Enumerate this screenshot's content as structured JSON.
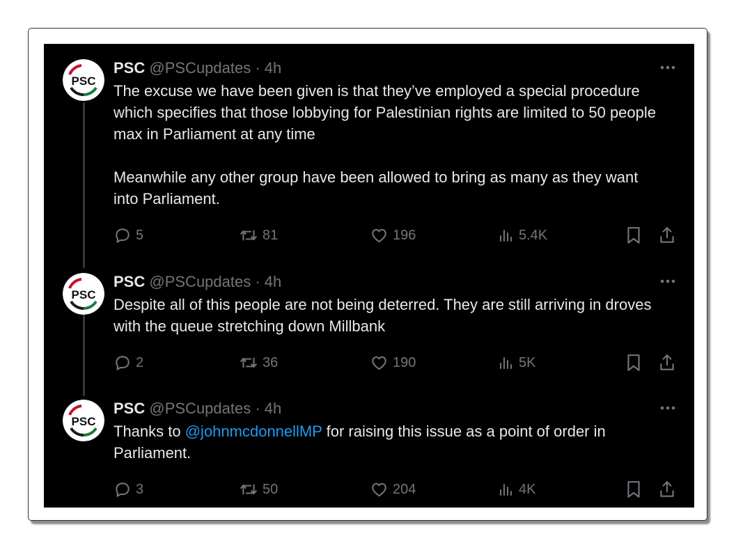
{
  "tweets": [
    {
      "author_name": "PSC",
      "handle": "@PSCupdates",
      "time": "· 4h",
      "avatar_text": "PSC",
      "paragraphs": [
        "The excuse we have been given is that they’ve employed a special procedure which specifies that those lobbying for Palestinian rights are limited to 50 people max in Parliament at any time",
        "Meanwhile any other group have been allowed to bring as many as they want into Parliament."
      ],
      "replies": "5",
      "reposts": "81",
      "likes": "196",
      "views": "5.4K"
    },
    {
      "author_name": "PSC",
      "handle": "@PSCupdates",
      "time": "· 4h",
      "avatar_text": "PSC",
      "paragraphs": [
        "Despite all of this people are not being deterred. They are still arriving in droves with the queue stretching down Millbank"
      ],
      "replies": "2",
      "reposts": "36",
      "likes": "190",
      "views": "5K"
    },
    {
      "author_name": "PSC",
      "handle": "@PSCupdates",
      "time": "· 4h",
      "avatar_text": "PSC",
      "text_before_mention": "Thanks to ",
      "mention": "@johnmcdonnellMP",
      "text_after_mention": " for raising this issue as a point of order in Parliament.",
      "replies": "3",
      "reposts": "50",
      "likes": "204",
      "views": "4K"
    }
  ],
  "colors": {
    "background": "#000000",
    "text": "#e7e9ea",
    "muted": "#71767b",
    "link": "#1d9bf0",
    "thread_line": "#333639"
  },
  "icons": [
    "reply-icon",
    "repost-icon",
    "like-icon",
    "views-icon",
    "bookmark-icon",
    "share-icon",
    "more-icon"
  ]
}
